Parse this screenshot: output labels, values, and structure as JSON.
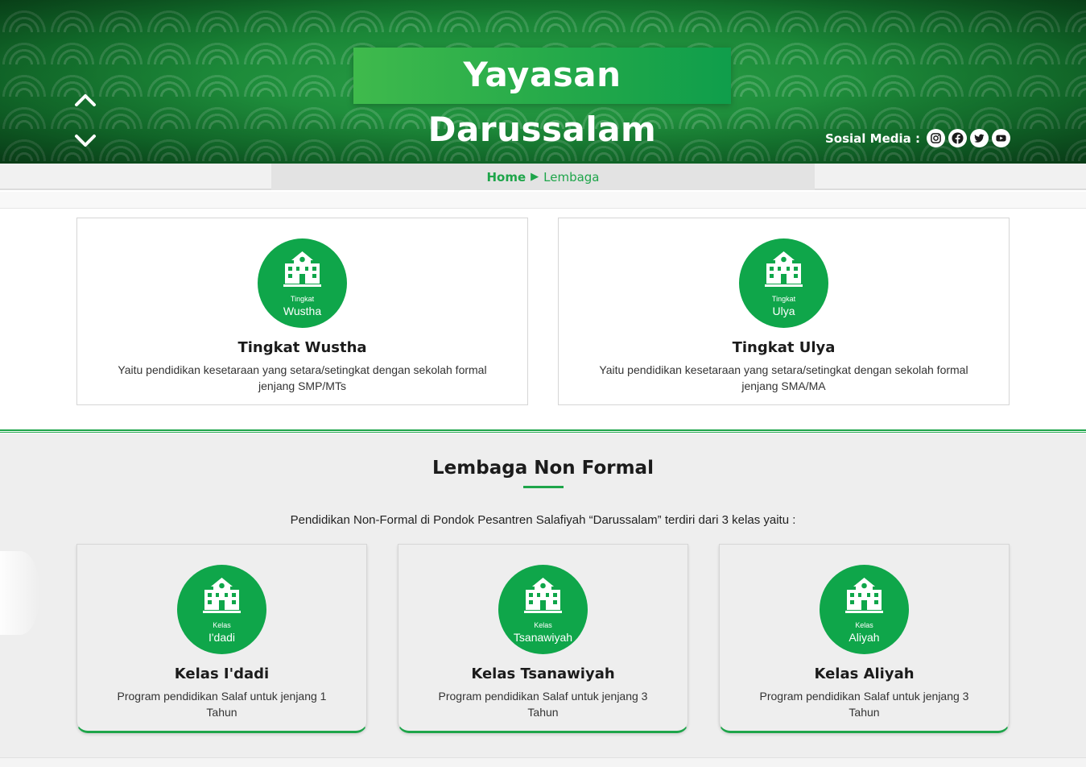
{
  "header": {
    "title": "Yayasan Darussalam",
    "social_label": "Sosial Media :",
    "social_icons": [
      "instagram-icon",
      "facebook-icon",
      "twitter-icon",
      "youtube-icon"
    ]
  },
  "breadcrumb": {
    "home": "Home",
    "separator": "▶",
    "current": "Lembaga"
  },
  "formal": [
    {
      "badge_small": "Tingkat",
      "badge_big": "Wustha",
      "title": "Tingkat Wustha",
      "desc": "Yaitu pendidikan kesetaraan yang setara/setingkat dengan sekolah formal jenjang SMP/MTs"
    },
    {
      "badge_small": "Tingkat",
      "badge_big": "Ulya",
      "title": "Tingkat Ulya",
      "desc": "Yaitu pendidikan kesetaraan yang setara/setingkat dengan sekolah formal jenjang SMA/MA"
    }
  ],
  "nonformal": {
    "title": "Lembaga Non Formal",
    "intro": "Pendidikan Non-Formal di Pondok Pesantren Salafiyah “Darussalam” terdiri dari 3 kelas yaitu :",
    "cards": [
      {
        "badge_small": "Kelas",
        "badge_big": "I'dadi",
        "title": "Kelas I'dadi",
        "desc": "Program pendidikan Salaf untuk jenjang 1 Tahun"
      },
      {
        "badge_small": "Kelas",
        "badge_big": "Tsanawiyah",
        "title": "Kelas Tsanawiyah",
        "desc": "Program pendidikan Salaf untuk jenjang 3 Tahun"
      },
      {
        "badge_small": "Kelas",
        "badge_big": "Aliyah",
        "title": "Kelas Aliyah",
        "desc": "Program pendidikan Salaf untuk jenjang 3 Tahun"
      }
    ]
  },
  "colors": {
    "accent": "#1ea54a",
    "badge": "#0fa64a",
    "header_bg": "#1f8a3a"
  }
}
